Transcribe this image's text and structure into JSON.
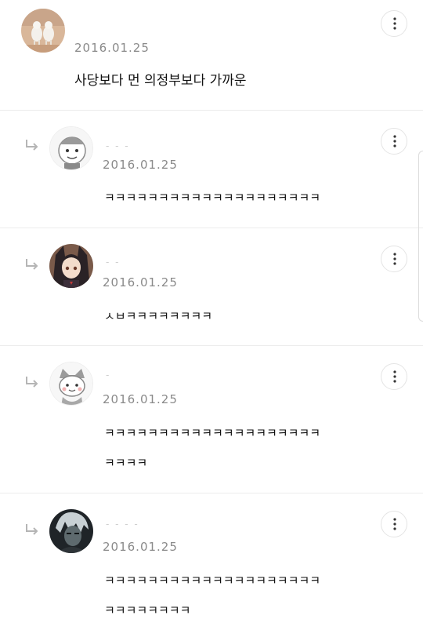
{
  "comments": [
    {
      "avatar": "avatar-alpacas-icon",
      "author": "",
      "date": "2016.01.25",
      "text_lines": [
        "사당보다 먼 의정부보다 가까운"
      ],
      "is_reply": false
    },
    {
      "avatar": "avatar-drawn-character-icon",
      "author": "- - -",
      "date": "2016.01.25",
      "text_lines": [
        "ㅋㅋㅋㅋㅋㅋㅋㅋㅋㅋㅋㅋㅋㅋㅋㅋㅋㅋㅋㅋ"
      ],
      "is_reply": true
    },
    {
      "avatar": "avatar-anime-girl-icon",
      "author": "- -",
      "date": "2016.01.25",
      "text_lines": [
        "ㅅㅂㅋㅋㅋㅋㅋㅋㅋㅋ"
      ],
      "is_reply": true
    },
    {
      "avatar": "avatar-cat-character-icon",
      "author": "-",
      "date": "2016.01.25",
      "text_lines": [
        "ㅋㅋㅋㅋㅋㅋㅋㅋㅋㅋㅋㅋㅋㅋㅋㅋㅋㅋㅋㅋ",
        "ㅋㅋㅋㅋ"
      ],
      "is_reply": true
    },
    {
      "avatar": "avatar-dark-character-icon",
      "author": "- - - -",
      "date": "2016.01.25",
      "text_lines": [
        "ㅋㅋㅋㅋㅋㅋㅋㅋㅋㅋㅋㅋㅋㅋㅋㅋㅋㅋㅋㅋ",
        "ㅋㅋㅋㅋㅋㅋㅋㅋ"
      ],
      "is_reply": true
    }
  ],
  "icons": {
    "more": "more-vertical-icon",
    "reply": "reply-arrow-icon"
  },
  "colors": {
    "divider": "#ececec",
    "date": "#8a8a8a",
    "text": "#111111",
    "button_border": "#e4e4e4"
  }
}
